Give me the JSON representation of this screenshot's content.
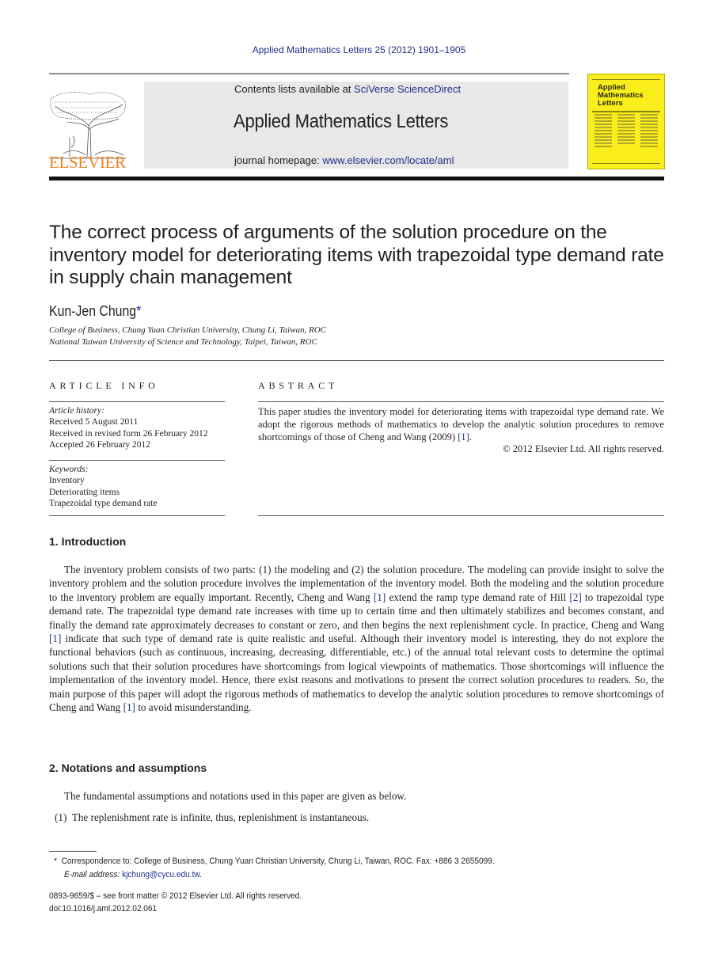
{
  "running_head": "Applied Mathematics Letters 25 (2012) 1901–1905",
  "header": {
    "publisher_logo_text": "ELSEVIER",
    "contents_prefix": "Contents lists available at ",
    "contents_link": "SciVerse ScienceDirect",
    "journal_title": "Applied Mathematics Letters",
    "homepage_prefix": "journal homepage: ",
    "homepage_link": "www.elsevier.com/locate/aml",
    "cover": {
      "title_line1": "Applied",
      "title_line2": "Mathematics",
      "title_line3": "Letters",
      "background_color": "#f9ed1b"
    },
    "logo_color": "#f0821e",
    "link_color": "#1f2e8a"
  },
  "article": {
    "title": "The correct process of arguments of the solution procedure on the inventory model for deteriorating items with trapezoidal type demand rate in supply chain management",
    "author": "Kun-Jen Chung",
    "author_mark": "*",
    "affiliations": [
      "College of Business, Chung Yuan Christian University, Chung Li, Taiwan, ROC",
      "National Taiwan University of Science and Technology, Taipei, Taiwan, ROC"
    ]
  },
  "article_info": {
    "heading": "ARTICLE INFO",
    "history_label": "Article history:",
    "history": [
      "Received 5 August 2011",
      "Received in revised form 26 February 2012",
      "Accepted 26 February 2012"
    ],
    "keywords_label": "Keywords:",
    "keywords": [
      "Inventory",
      "Deteriorating items",
      "Trapezoidal type demand rate"
    ]
  },
  "abstract": {
    "heading": "ABSTRACT",
    "text": "This paper studies the inventory model for deteriorating items with trapezoidal type demand rate. We adopt the rigorous methods of mathematics to develop the analytic solution procedures to remove shortcomings of those of Cheng and Wang (2009) ",
    "ref": "[1]",
    "text_end": ".",
    "copyright": "© 2012 Elsevier Ltd. All rights reserved."
  },
  "sections": [
    {
      "heading": "1.  Introduction",
      "paragraph_parts": [
        "The inventory problem consists of two parts: (1) the modeling and (2) the solution procedure. The modeling can provide insight to solve the inventory problem and the solution procedure involves the implementation of the inventory model. Both the modeling and the solution procedure to the inventory problem are equally important. Recently, Cheng and Wang ",
        "[1]",
        " extend the ramp type demand rate of Hill ",
        "[2]",
        " to trapezoidal type demand rate. The trapezoidal type demand rate increases with time up to certain time and then ultimately stabilizes and becomes constant, and finally the demand rate approximately decreases to constant or zero, and then begins the next replenishment cycle. In practice, Cheng and Wang ",
        "[1]",
        " indicate that such type of demand rate is quite realistic and useful. Although their inventory model is interesting, they do not explore the functional behaviors (such as continuous, increasing, decreasing, differentiable, etc.) of the annual total relevant costs to determine the optimal solutions such that their solution procedures have shortcomings from logical viewpoints of mathematics. Those shortcomings will influence the implementation of the inventory model. Hence, there exist reasons and motivations to present the correct solution procedures to readers. So, the main purpose of this paper will adopt the rigorous methods of mathematics to develop the analytic solution procedures to remove shortcomings of Cheng and Wang ",
        "[1]",
        " to avoid misunderstanding."
      ]
    },
    {
      "heading": "2.  Notations and assumptions",
      "paragraph": "The fundamental assumptions and notations used in this paper are given as below.",
      "list": [
        {
          "marker": "(1)",
          "text": "The replenishment rate is infinite, thus, replenishment is instantaneous."
        }
      ]
    }
  ],
  "footnote": {
    "mark": "*",
    "correspondence": "Correspondence to: College of Business, Chung Yuan Christian University, Chung Li, Taiwan, ROC. Fax: +886 3 2655099.",
    "email_label": "E-mail address:",
    "email": "kjchung@cycu.edu.tw",
    "email_end": "."
  },
  "front_matter": {
    "issn_line": "0893-9659/$ – see front matter © 2012 Elsevier Ltd. All rights reserved.",
    "doi": "doi:10.1016/j.aml.2012.02.061"
  }
}
